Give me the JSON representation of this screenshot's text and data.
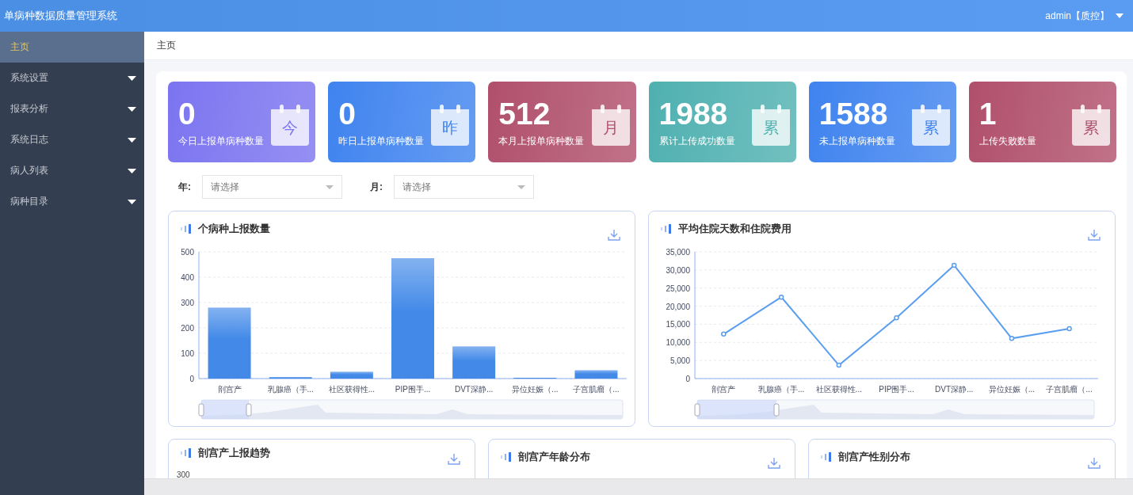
{
  "header": {
    "title": "单病种数据质量管理系统",
    "user": "admin【质控】"
  },
  "sidebar": {
    "items": [
      {
        "label": "主页",
        "selected": true,
        "has_children": false
      },
      {
        "label": "系统设置",
        "selected": false,
        "has_children": true
      },
      {
        "label": "报表分析",
        "selected": false,
        "has_children": true
      },
      {
        "label": "系统日志",
        "selected": false,
        "has_children": true
      },
      {
        "label": "病人列表",
        "selected": false,
        "has_children": true
      },
      {
        "label": "病种目录",
        "selected": false,
        "has_children": true
      }
    ]
  },
  "breadcrumb": "主页",
  "stat_cards": [
    {
      "value": "0",
      "label": "今日上报单病种数量",
      "badge": "今",
      "color": "#7b74f0"
    },
    {
      "value": "0",
      "label": "昨日上报单病种数量",
      "badge": "昨",
      "color": "#3f83ef"
    },
    {
      "value": "512",
      "label": "本月上报单病种数量",
      "badge": "月",
      "color": "#b04f6c"
    },
    {
      "value": "1988",
      "label": "累计上传成功数量",
      "badge": "累",
      "color": "#4fb0b0"
    },
    {
      "value": "1588",
      "label": "未上报单病种数量",
      "badge": "累",
      "color": "#3f83ef"
    },
    {
      "value": "1",
      "label": "上传失败数量",
      "badge": "累",
      "color": "#b04f6c"
    }
  ],
  "filters": [
    {
      "label": "年:",
      "placeholder": "请选择"
    },
    {
      "label": "月:",
      "placeholder": "请选择"
    }
  ],
  "charts": [
    {
      "title": "个病种上报数量",
      "chart_data": {
        "type": "bar",
        "categories": [
          "剖宫产",
          "乳腺癌（手...",
          "社区获得性...",
          "PIP围手...",
          "DVT深静...",
          "异位妊娠（...",
          "子宫肌瘤（..."
        ],
        "grid": true,
        "series": [
          {
            "color": "#4289e8",
            "values": [
              280,
              6,
              27,
              475,
              127,
              3,
              33
            ]
          }
        ],
        "ylim": [
          0,
          500
        ],
        "yticks": [
          0,
          100,
          200,
          300,
          400,
          500
        ]
      }
    },
    {
      "title": "平均住院天数和住院费用",
      "chart_data": {
        "type": "line",
        "categories": [
          "剖宫产",
          "乳腺癌（手...",
          "社区获得性...",
          "PIP围手...",
          "DVT深静...",
          "异位妊娠（...",
          "子宫肌瘤（..."
        ],
        "grid": true,
        "series": [
          {
            "color": "#5b9ef0",
            "marker": true,
            "values": [
              12300,
              22500,
              3700,
              16800,
              31300,
              11100,
              13800
            ]
          }
        ],
        "ylim": [
          0,
          35000
        ],
        "yticks": [
          {
            "value": 0,
            "label": "0"
          },
          {
            "value": 5000,
            "label": "5,000"
          },
          {
            "value": 10000,
            "label": "10,000"
          },
          {
            "value": 15000,
            "label": "15,000"
          },
          {
            "value": 20000,
            "label": "20,000"
          },
          {
            "value": 25000,
            "label": "25,000"
          },
          {
            "value": 30000,
            "label": "30,000"
          },
          {
            "value": 35000,
            "label": "35,000"
          }
        ]
      }
    }
  ],
  "lower_panels": [
    {
      "title": "剖宫产上报趋势",
      "partial_tick": "300"
    },
    {
      "title": "剖宫产年龄分布"
    },
    {
      "title": "剖宫产性别分布"
    }
  ]
}
